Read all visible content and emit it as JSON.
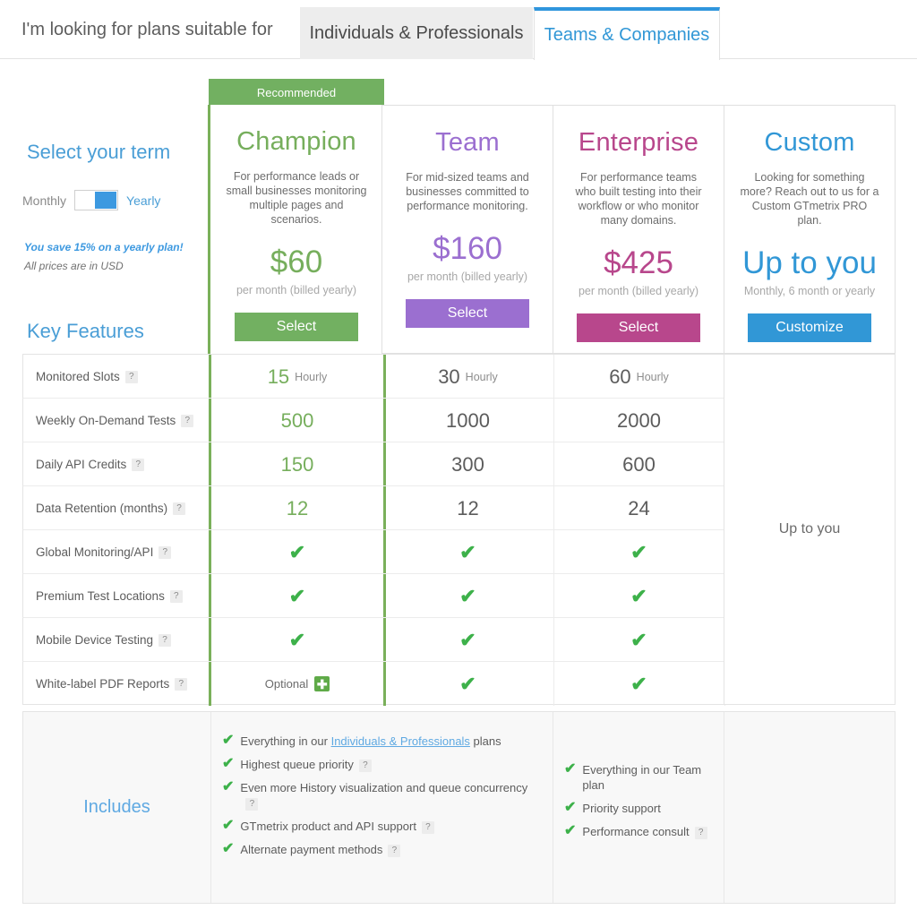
{
  "header": {
    "intro": "I'm looking for plans suitable for",
    "tabs": [
      {
        "label": "Individuals & Professionals",
        "active": false
      },
      {
        "label": "Teams & Companies",
        "active": true
      }
    ]
  },
  "sidebar": {
    "term_title": "Select your term",
    "toggle": {
      "left_label": "Monthly",
      "right_label": "Yearly",
      "selected": "Yearly"
    },
    "save_note": "You save 15% on a yearly plan!",
    "currency_note": "All prices are in USD",
    "key_features_title": "Key Features",
    "includes_label": "Includes"
  },
  "recommended_banner": "Recommended",
  "plans": [
    {
      "name": "Champion",
      "description": "For performance leads or small businesses monitoring multiple pages and scenarios.",
      "price": "$60",
      "period": "per month (billed yearly)",
      "button": "Select",
      "color": "#76ae5c"
    },
    {
      "name": "Team",
      "description": "For mid-sized teams and businesses committed to performance monitoring.",
      "price": "$160",
      "period": "per month (billed yearly)",
      "button": "Select",
      "color": "#9b6fd0"
    },
    {
      "name": "Enterprise",
      "description": "For performance teams who built testing into their workflow or who monitor many domains.",
      "price": "$425",
      "period": "per month (billed yearly)",
      "button": "Select",
      "color": "#b8478c"
    },
    {
      "name": "Custom",
      "description": "Looking for something more? Reach out to us for a Custom GTmetrix PRO plan.",
      "price": "Up to you",
      "period": "Monthly, 6 month or yearly",
      "button": "Customize",
      "color": "#3197d6"
    }
  ],
  "features": [
    {
      "label": "Monitored Slots",
      "champion": "15",
      "champion_unit": "Hourly",
      "team": "30",
      "team_unit": "Hourly",
      "enterprise": "60",
      "enterprise_unit": "Hourly"
    },
    {
      "label": "Weekly On-Demand Tests",
      "champion": "500",
      "champion_unit": "",
      "team": "1000",
      "team_unit": "",
      "enterprise": "2000",
      "enterprise_unit": ""
    },
    {
      "label": "Daily API Credits",
      "champion": "150",
      "champion_unit": "",
      "team": "300",
      "team_unit": "",
      "enterprise": "600",
      "enterprise_unit": ""
    },
    {
      "label": "Data Retention (months)",
      "champion": "12",
      "champion_unit": "",
      "team": "12",
      "team_unit": "",
      "enterprise": "24",
      "enterprise_unit": ""
    },
    {
      "label": "Global Monitoring/API",
      "champion": "check",
      "champion_unit": "",
      "team": "check",
      "team_unit": "",
      "enterprise": "check",
      "enterprise_unit": ""
    },
    {
      "label": "Premium Test Locations",
      "champion": "check",
      "champion_unit": "",
      "team": "check",
      "team_unit": "",
      "enterprise": "check",
      "enterprise_unit": ""
    },
    {
      "label": "Mobile Device Testing",
      "champion": "check",
      "champion_unit": "",
      "team": "check",
      "team_unit": "",
      "enterprise": "check",
      "enterprise_unit": ""
    },
    {
      "label": "White-label PDF Reports",
      "champion": "Optional",
      "champion_unit": "plus",
      "team": "check",
      "team_unit": "",
      "enterprise": "check",
      "enterprise_unit": ""
    }
  ],
  "custom_column_value": "Up to you",
  "includes": {
    "champion": [
      {
        "pre": "Everything in our ",
        "link": "Individuals & Professionals",
        "post": " plans",
        "help": false
      },
      {
        "pre": "Highest queue priority",
        "link": "",
        "post": "",
        "help": true
      },
      {
        "pre": "Even more History visualization and queue concurrency",
        "link": "",
        "post": "",
        "help": true
      },
      {
        "pre": "GTmetrix product and API support",
        "link": "",
        "post": "",
        "help": true
      },
      {
        "pre": "Alternate payment methods",
        "link": "",
        "post": "",
        "help": true
      }
    ],
    "enterprise": [
      {
        "pre": "Everything in our Team plan",
        "link": "",
        "post": "",
        "help": false
      },
      {
        "pre": "Priority support",
        "link": "",
        "post": "",
        "help": false
      },
      {
        "pre": "Performance consult",
        "link": "",
        "post": "",
        "help": true
      }
    ]
  },
  "icons": {
    "help": "?",
    "check": "✔",
    "plus": "✚"
  }
}
